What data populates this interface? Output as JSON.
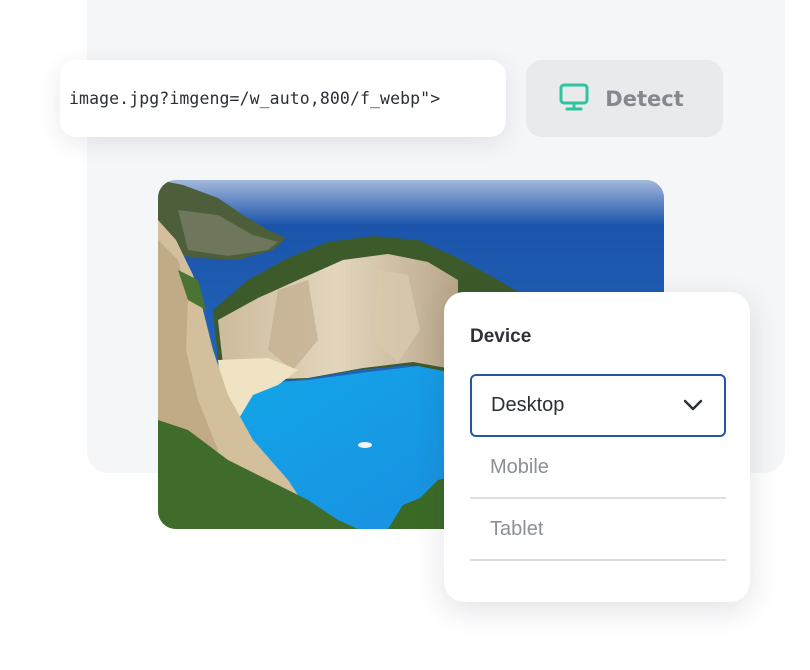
{
  "url_field": {
    "value": "image.jpg?imgeng=/w_auto,800/f_webp\">"
  },
  "detect_button": {
    "label": "Detect",
    "icon": "monitor-icon",
    "icon_color": "#2ec4a0"
  },
  "photo": {
    "icon": "landscape-photo"
  },
  "device_dropdown": {
    "title": "Device",
    "selected": "Desktop",
    "chevron_icon": "chevron-down-icon",
    "options": [
      "Mobile",
      "Tablet"
    ],
    "accent_color": "#2455a8"
  }
}
